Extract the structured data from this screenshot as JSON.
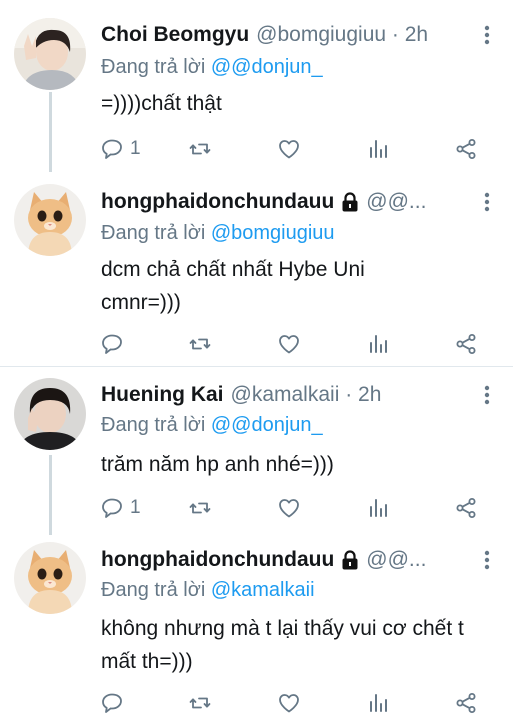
{
  "reply_prefix": "Đang trả lời",
  "colors": {
    "mention": "#1d9bf0",
    "muted": "#657786",
    "divider": "#e1e8ed"
  },
  "tweets": [
    {
      "name": "Choi Beomgyu",
      "handle": "@bomgiugiuu · 2h",
      "replying_to": "@@donjun_",
      "text": "=))))chất thật",
      "reply_count": "1",
      "avatar_icon": "person-photo-avatar",
      "locked": false
    },
    {
      "name": "hongphaidonchundauu",
      "handle": "@@...",
      "replying_to": "@bomgiugiuu",
      "text": "dcm chả chất nhất Hybe Uni cmnr=)))",
      "reply_count": "",
      "avatar_icon": "cat-photo-avatar",
      "locked": true
    },
    {
      "name": "Huening Kai",
      "handle": "@kamalkaii · 2h",
      "replying_to": "@@donjun_",
      "text": "trăm năm hp anh nhé=)))",
      "reply_count": "1",
      "avatar_icon": "person-photo-avatar",
      "locked": false
    },
    {
      "name": "hongphaidonchundauu",
      "handle": "@@...",
      "replying_to": "@kamalkaii",
      "text": "không nhưng mà t lại thấy vui cơ chết t mất th=)))",
      "reply_count": "",
      "avatar_icon": "cat-photo-avatar",
      "locked": true
    }
  ]
}
